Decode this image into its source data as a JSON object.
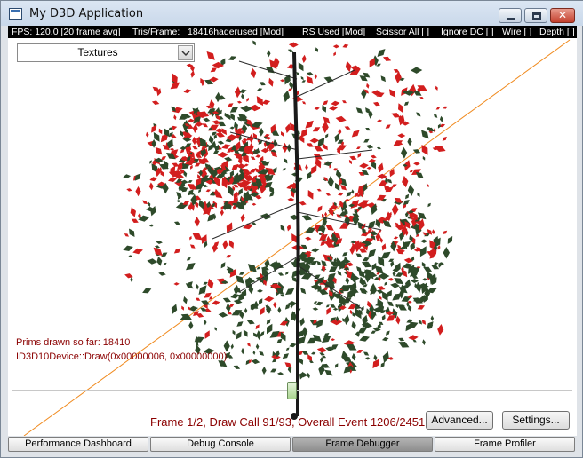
{
  "window": {
    "title": "My D3D Application",
    "controls": {
      "minimize": "minimize",
      "maximize": "maximize",
      "close": "✕"
    }
  },
  "hud": {
    "fps": "FPS: 120.0 [20 frame avg]",
    "tris": "Tris/Frame:",
    "tris_value": "18416haderused [Mod]",
    "rs_used": "RS Used [Mod]",
    "scissor": "Scissor All [ ]",
    "ignore_dc": "Ignore DC [ ]",
    "wire": "Wire [ ]",
    "depth": "Depth [ ]"
  },
  "texture_select": {
    "value": "Textures"
  },
  "debug": {
    "prims": "Prims drawn so far: 18410",
    "draw_call": "ID3D10Device::Draw(0x00000006, 0x00000000)",
    "frame_info": "Frame 1/2, Draw Call 91/93, Overall Event 1206/2451"
  },
  "event_slider": {
    "position_fraction": 0.5
  },
  "buttons": {
    "advanced": "Advanced...",
    "settings": "Settings..."
  },
  "tabs": [
    {
      "label": "Performance Dashboard",
      "active": false
    },
    {
      "label": "Debug Console",
      "active": false
    },
    {
      "label": "Frame Debugger",
      "active": true
    },
    {
      "label": "Frame Profiler",
      "active": false
    }
  ],
  "colors": {
    "leaf_red": "#d21e1e",
    "leaf_green": "#2e4a2a",
    "trunk": "#1a1a1a",
    "guide_line": "#f08a1e",
    "debug_text": "#8b0000"
  }
}
